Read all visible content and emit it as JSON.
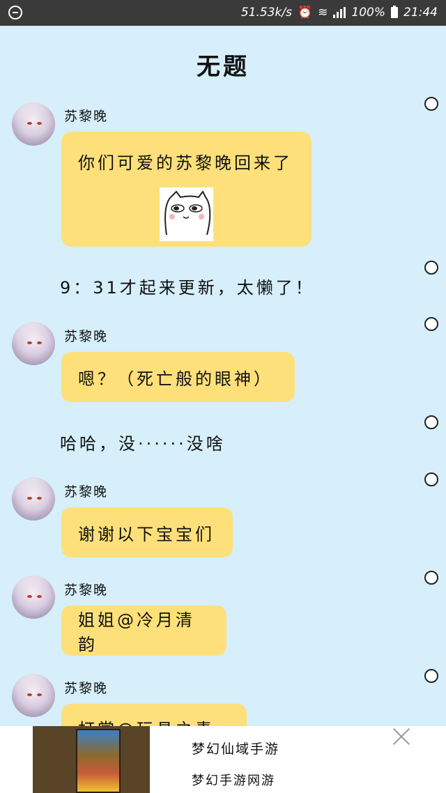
{
  "status_bar": {
    "speed": "51.53k/s",
    "battery": "100%",
    "time": "21:44"
  },
  "title": "无题",
  "messages": [
    {
      "sender": "苏黎晚",
      "text": "你们可爱的苏黎晚回来了"
    },
    {
      "text": "9：31才起来更新，太懒了！"
    },
    {
      "sender": "苏黎晚",
      "text": "嗯？（死亡般的眼神）"
    },
    {
      "text": "哈哈，没······没啥"
    },
    {
      "sender": "苏黎晚",
      "text": "谢谢以下宝宝们"
    },
    {
      "sender": "苏黎晚",
      "text": "姐姐@冷月清韵"
    },
    {
      "sender": "苏黎晚",
      "text": "打赏@玩具之青花"
    }
  ],
  "ad": {
    "title": "梦幻仙域手游",
    "subtitle": "梦幻手游网游"
  }
}
